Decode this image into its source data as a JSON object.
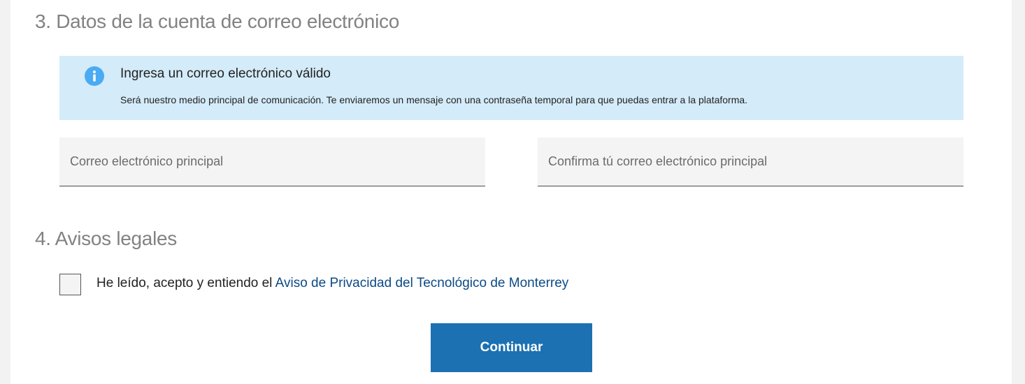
{
  "section_email": {
    "title": "3. Datos de la cuenta de correo electrónico",
    "info_box": {
      "icon": "info-icon",
      "icon_color": "#4aabf2",
      "background_color": "#d4ebf9",
      "title": "Ingresa un correo electrónico válido",
      "text": "Será nuestro medio principal de comunicación. Te enviaremos un mensaje con una contraseña temporal para que puedas entrar a la plataforma."
    },
    "email_field": {
      "value": "",
      "placeholder": "Correo electrónico principal"
    },
    "confirm_email_field": {
      "value": "",
      "placeholder": "Confirma tú correo electrónico principal"
    }
  },
  "section_legal": {
    "title": "4. Avisos legales",
    "checkbox_checked": false,
    "text_prefix": "He leído, acepto y entiendo el ",
    "link_text": "Aviso de Privacidad del Tecnológico de Monterrey",
    "link_color": "#0b4a86"
  },
  "continue_button": {
    "label": "Continuar",
    "color": "#1c71b2"
  }
}
